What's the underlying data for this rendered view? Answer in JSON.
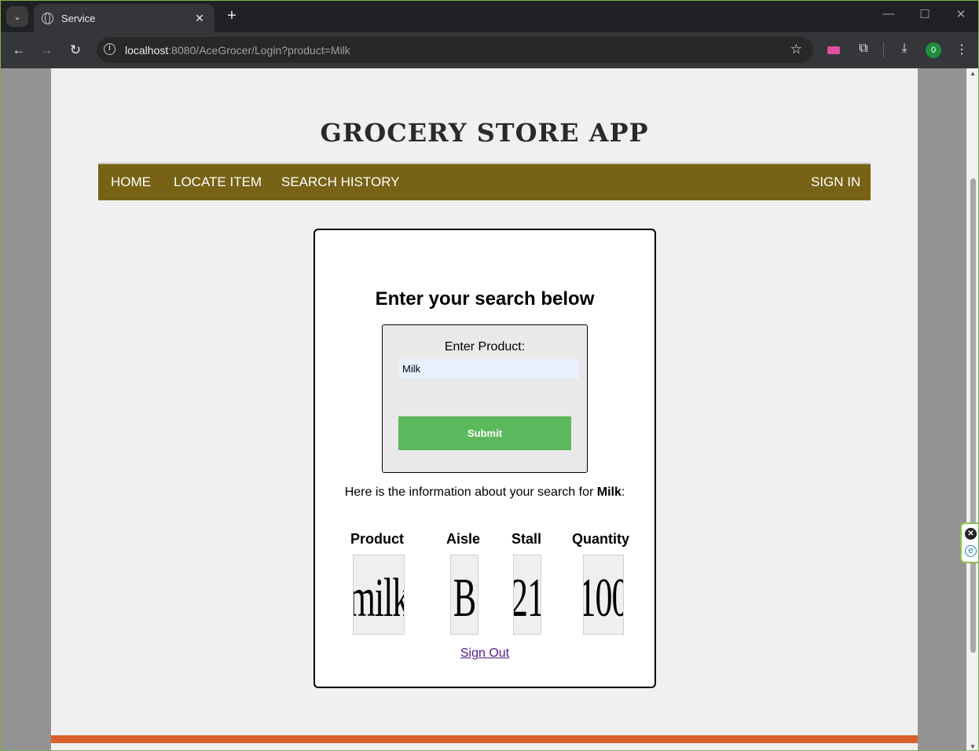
{
  "browser": {
    "tab_title": "Service",
    "tab_close": "✕",
    "new_tab": "+",
    "window_controls": {
      "minimize": "—",
      "maximize": "☐",
      "close": "✕"
    },
    "url_host": "localhost",
    "url_rest": ":8080/AceGrocer/Login?product=Milk",
    "profile_initial": "0",
    "toolbar_icons": {
      "back": "back-arrow-icon",
      "forward": "forward-arrow-icon",
      "reload": "reload-icon",
      "star": "star-icon",
      "extensions": "puzzle-icon",
      "download": "download-icon",
      "menu": "kebab-menu-icon"
    }
  },
  "site": {
    "title": "GROCERY STORE APP",
    "nav": {
      "home": "HOME",
      "locate": "LOCATE ITEM",
      "history": "SEARCH HISTORY",
      "signin": "SIGN IN"
    },
    "colors": {
      "nav_bg": "#776315",
      "submit_bg": "#5cb85c",
      "footer_bar": "#d9622b"
    }
  },
  "search": {
    "heading": "Enter your search below",
    "label": "Enter Product:",
    "value": "Milk",
    "submit": "Submit",
    "info_prefix": "Here is the information about your search for ",
    "info_product": "Milk",
    "info_suffix": ":"
  },
  "results": {
    "headers": {
      "product": "Product",
      "aisle": "Aisle",
      "stall": "Stall",
      "quantity": "Quantity"
    },
    "values": {
      "product": "milk",
      "aisle": "B",
      "stall": "21",
      "quantity": "100"
    }
  },
  "signout": "Sign Out"
}
